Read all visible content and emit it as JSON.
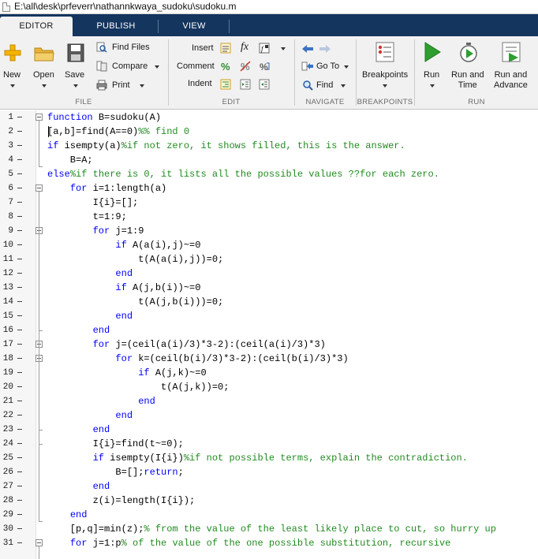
{
  "window": {
    "title_path": "E:\\all\\desk\\prfeverr\\nathannkwaya_sudoku\\sudoku.m"
  },
  "tabs": [
    {
      "label": "EDITOR",
      "active": true
    },
    {
      "label": "PUBLISH",
      "active": false
    },
    {
      "label": "VIEW",
      "active": false
    }
  ],
  "ribbon": {
    "file": {
      "section": "FILE",
      "new": "New",
      "open": "Open",
      "save": "Save",
      "find_files": "Find Files",
      "compare": "Compare",
      "print": "Print"
    },
    "edit": {
      "section": "EDIT",
      "insert": "Insert",
      "comment": "Comment",
      "indent": "Indent",
      "fx_glyph": "fx"
    },
    "navigate": {
      "section": "NAVIGATE",
      "goto": "Go To",
      "find": "Find"
    },
    "breakpoints": {
      "section": "BREAKPOINTS",
      "label": "Breakpoints"
    },
    "run": {
      "section": "RUN",
      "run": "Run",
      "run_time": "Run and\nTime",
      "run_advance": "Run and\nAdvance"
    }
  },
  "colors": {
    "tabbar": "#13355e",
    "keyword": "#0000ff",
    "comment": "#228b22",
    "run_green": "#2e9e2e"
  },
  "editor": {
    "lines": [
      {
        "n": "1",
        "parts": [
          [
            "kw",
            "function"
          ],
          [
            "",
            "B=sudoku(A)"
          ]
        ]
      },
      {
        "n": "2",
        "parts": [
          [
            "",
            "[a,b]=find(A==0)"
          ],
          [
            "cm",
            "%% find 0"
          ]
        ]
      },
      {
        "n": "3",
        "parts": [
          [
            "kw",
            "if"
          ],
          [
            "",
            "isempty(a)"
          ],
          [
            "cm",
            "%if not zero, it shows filled, this is the answer."
          ]
        ]
      },
      {
        "n": "4",
        "parts": [
          [
            "",
            "    B=A;"
          ]
        ]
      },
      {
        "n": "5",
        "parts": [
          [
            "kw",
            "else"
          ],
          [
            "cm",
            "%if there is 0, it lists all the possible values ??for each zero."
          ]
        ]
      },
      {
        "n": "6",
        "parts": [
          [
            "",
            "    "
          ],
          [
            "kw",
            "for"
          ],
          [
            "",
            "i=1:length(a)"
          ]
        ]
      },
      {
        "n": "7",
        "parts": [
          [
            "",
            "        I{i}=[];"
          ]
        ]
      },
      {
        "n": "8",
        "parts": [
          [
            "",
            "        t=1:9;"
          ]
        ]
      },
      {
        "n": "9",
        "parts": [
          [
            "",
            "        "
          ],
          [
            "kw",
            "for"
          ],
          [
            "",
            "j=1:9"
          ]
        ]
      },
      {
        "n": "10",
        "parts": [
          [
            "",
            "            "
          ],
          [
            "kw",
            "if"
          ],
          [
            "",
            "A(a(i),j)~=0"
          ]
        ]
      },
      {
        "n": "11",
        "parts": [
          [
            "",
            "                t(A(a(i),j))=0;"
          ]
        ]
      },
      {
        "n": "12",
        "parts": [
          [
            "",
            "            "
          ],
          [
            "kw",
            "end"
          ]
        ]
      },
      {
        "n": "13",
        "parts": [
          [
            "",
            "            "
          ],
          [
            "kw",
            "if"
          ],
          [
            "",
            "A(j,b(i))~=0"
          ]
        ]
      },
      {
        "n": "14",
        "parts": [
          [
            "",
            "                t(A(j,b(i)))=0;"
          ]
        ]
      },
      {
        "n": "15",
        "parts": [
          [
            "",
            "            "
          ],
          [
            "kw",
            "end"
          ]
        ]
      },
      {
        "n": "16",
        "parts": [
          [
            "",
            "        "
          ],
          [
            "kw",
            "end"
          ]
        ]
      },
      {
        "n": "17",
        "parts": [
          [
            "",
            "        "
          ],
          [
            "kw",
            "for"
          ],
          [
            "",
            "j=(ceil(a(i)/3)*3-2):(ceil(a(i)/3)*3)"
          ]
        ]
      },
      {
        "n": "18",
        "parts": [
          [
            "",
            "            "
          ],
          [
            "kw",
            "for"
          ],
          [
            "",
            "k=(ceil(b(i)/3)*3-2):(ceil(b(i)/3)*3)"
          ]
        ]
      },
      {
        "n": "19",
        "parts": [
          [
            "",
            "                "
          ],
          [
            "kw",
            "if"
          ],
          [
            "",
            "A(j,k)~=0"
          ]
        ]
      },
      {
        "n": "20",
        "parts": [
          [
            "",
            "                    t(A(j,k))=0;"
          ]
        ]
      },
      {
        "n": "21",
        "parts": [
          [
            "",
            "                "
          ],
          [
            "kw",
            "end"
          ]
        ]
      },
      {
        "n": "22",
        "parts": [
          [
            "",
            "            "
          ],
          [
            "kw",
            "end"
          ]
        ]
      },
      {
        "n": "23",
        "parts": [
          [
            "",
            "        "
          ],
          [
            "kw",
            "end"
          ]
        ]
      },
      {
        "n": "24",
        "parts": [
          [
            "",
            "        I{i}=find(t~=0);"
          ]
        ]
      },
      {
        "n": "25",
        "parts": [
          [
            "",
            "        "
          ],
          [
            "kw",
            "if"
          ],
          [
            "",
            "isempty(I{i})"
          ],
          [
            "cm",
            "%if not possible terms, explain the contradiction."
          ]
        ]
      },
      {
        "n": "26",
        "parts": [
          [
            "",
            "            B=[];"
          ],
          [
            "kw",
            "return"
          ],
          [
            "",
            ";"
          ]
        ]
      },
      {
        "n": "27",
        "parts": [
          [
            "",
            "        "
          ],
          [
            "kw",
            "end"
          ]
        ]
      },
      {
        "n": "28",
        "parts": [
          [
            "",
            "        z(i)=length(I{i});"
          ]
        ]
      },
      {
        "n": "29",
        "parts": [
          [
            "",
            "    "
          ],
          [
            "kw",
            "end"
          ]
        ]
      },
      {
        "n": "30",
        "parts": [
          [
            "",
            "    [p,q]=min(z);"
          ],
          [
            "cm",
            "% from the value of the least likely place to cut, so hurry up"
          ]
        ]
      },
      {
        "n": "31",
        "parts": [
          [
            "",
            "    "
          ],
          [
            "kw",
            "for"
          ],
          [
            "",
            "j=1:p"
          ],
          [
            "cm",
            "% of the value of the one possible substitution, recursive"
          ]
        ]
      }
    ]
  }
}
